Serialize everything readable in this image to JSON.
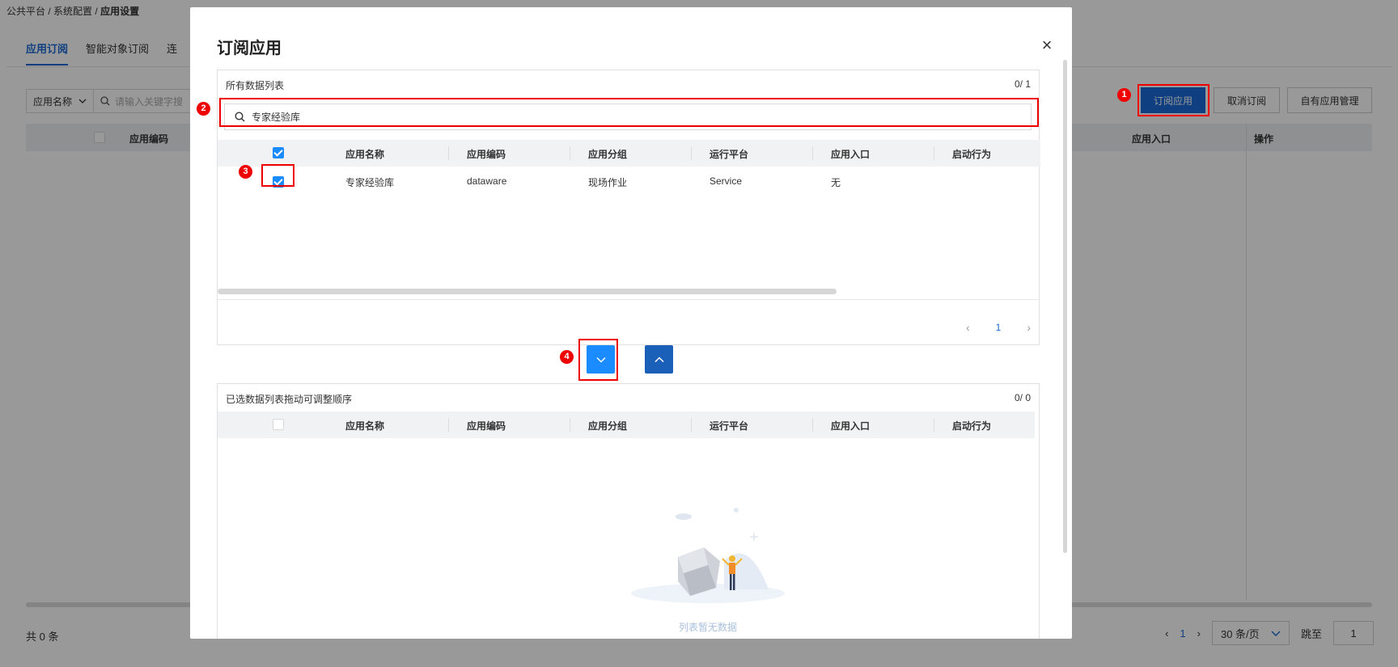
{
  "breadcrumb": {
    "items": [
      "公共平台",
      "系统配置"
    ],
    "current": "应用设置",
    "sep": " / "
  },
  "tabs": [
    {
      "label": "应用订阅"
    },
    {
      "label": "智能对象订阅"
    },
    {
      "label": "连"
    }
  ],
  "filter": {
    "select_label": "应用名称",
    "placeholder": "请输入关键字搜"
  },
  "toolbar": {
    "subscribe": "订阅应用",
    "unsubscribe": "取消订阅",
    "own_apps": "自有应用管理"
  },
  "bg_table": {
    "col_code": "应用编码",
    "col_entry": "应用入口",
    "col_op": "操作"
  },
  "bg_footer": {
    "total": "共 0 条",
    "page": "1",
    "page_size": "30 条/页",
    "jump_label": "跳至",
    "jump_value": "1"
  },
  "modal": {
    "title": "订阅应用",
    "close": "×",
    "all_list": {
      "title": "所有数据列表",
      "count": "0/ 1",
      "search_value": "专家经验库",
      "columns": [
        "应用名称",
        "应用编码",
        "应用分组",
        "运行平台",
        "应用入口",
        "启动行为"
      ],
      "rows": [
        {
          "name": "专家经验库",
          "code": "dataware",
          "group": "现场作业",
          "platform": "Service",
          "entry": "无",
          "behavior": ""
        }
      ],
      "page": "1"
    },
    "selected_list": {
      "title": "已选数据列表",
      "hint": "拖动可调整顺序",
      "count": "0/ 0",
      "columns": [
        "应用名称",
        "应用编码",
        "应用分组",
        "运行平台",
        "应用入口",
        "启动行为"
      ],
      "empty_text": "列表暂无数据"
    }
  },
  "annotations": [
    "1",
    "2",
    "3",
    "4"
  ],
  "colors": {
    "primary": "#1a6ad6",
    "checkbox": "#1a8cff",
    "annotation": "#ee0000",
    "mask": "rgba(0,0,0,0.4)"
  }
}
